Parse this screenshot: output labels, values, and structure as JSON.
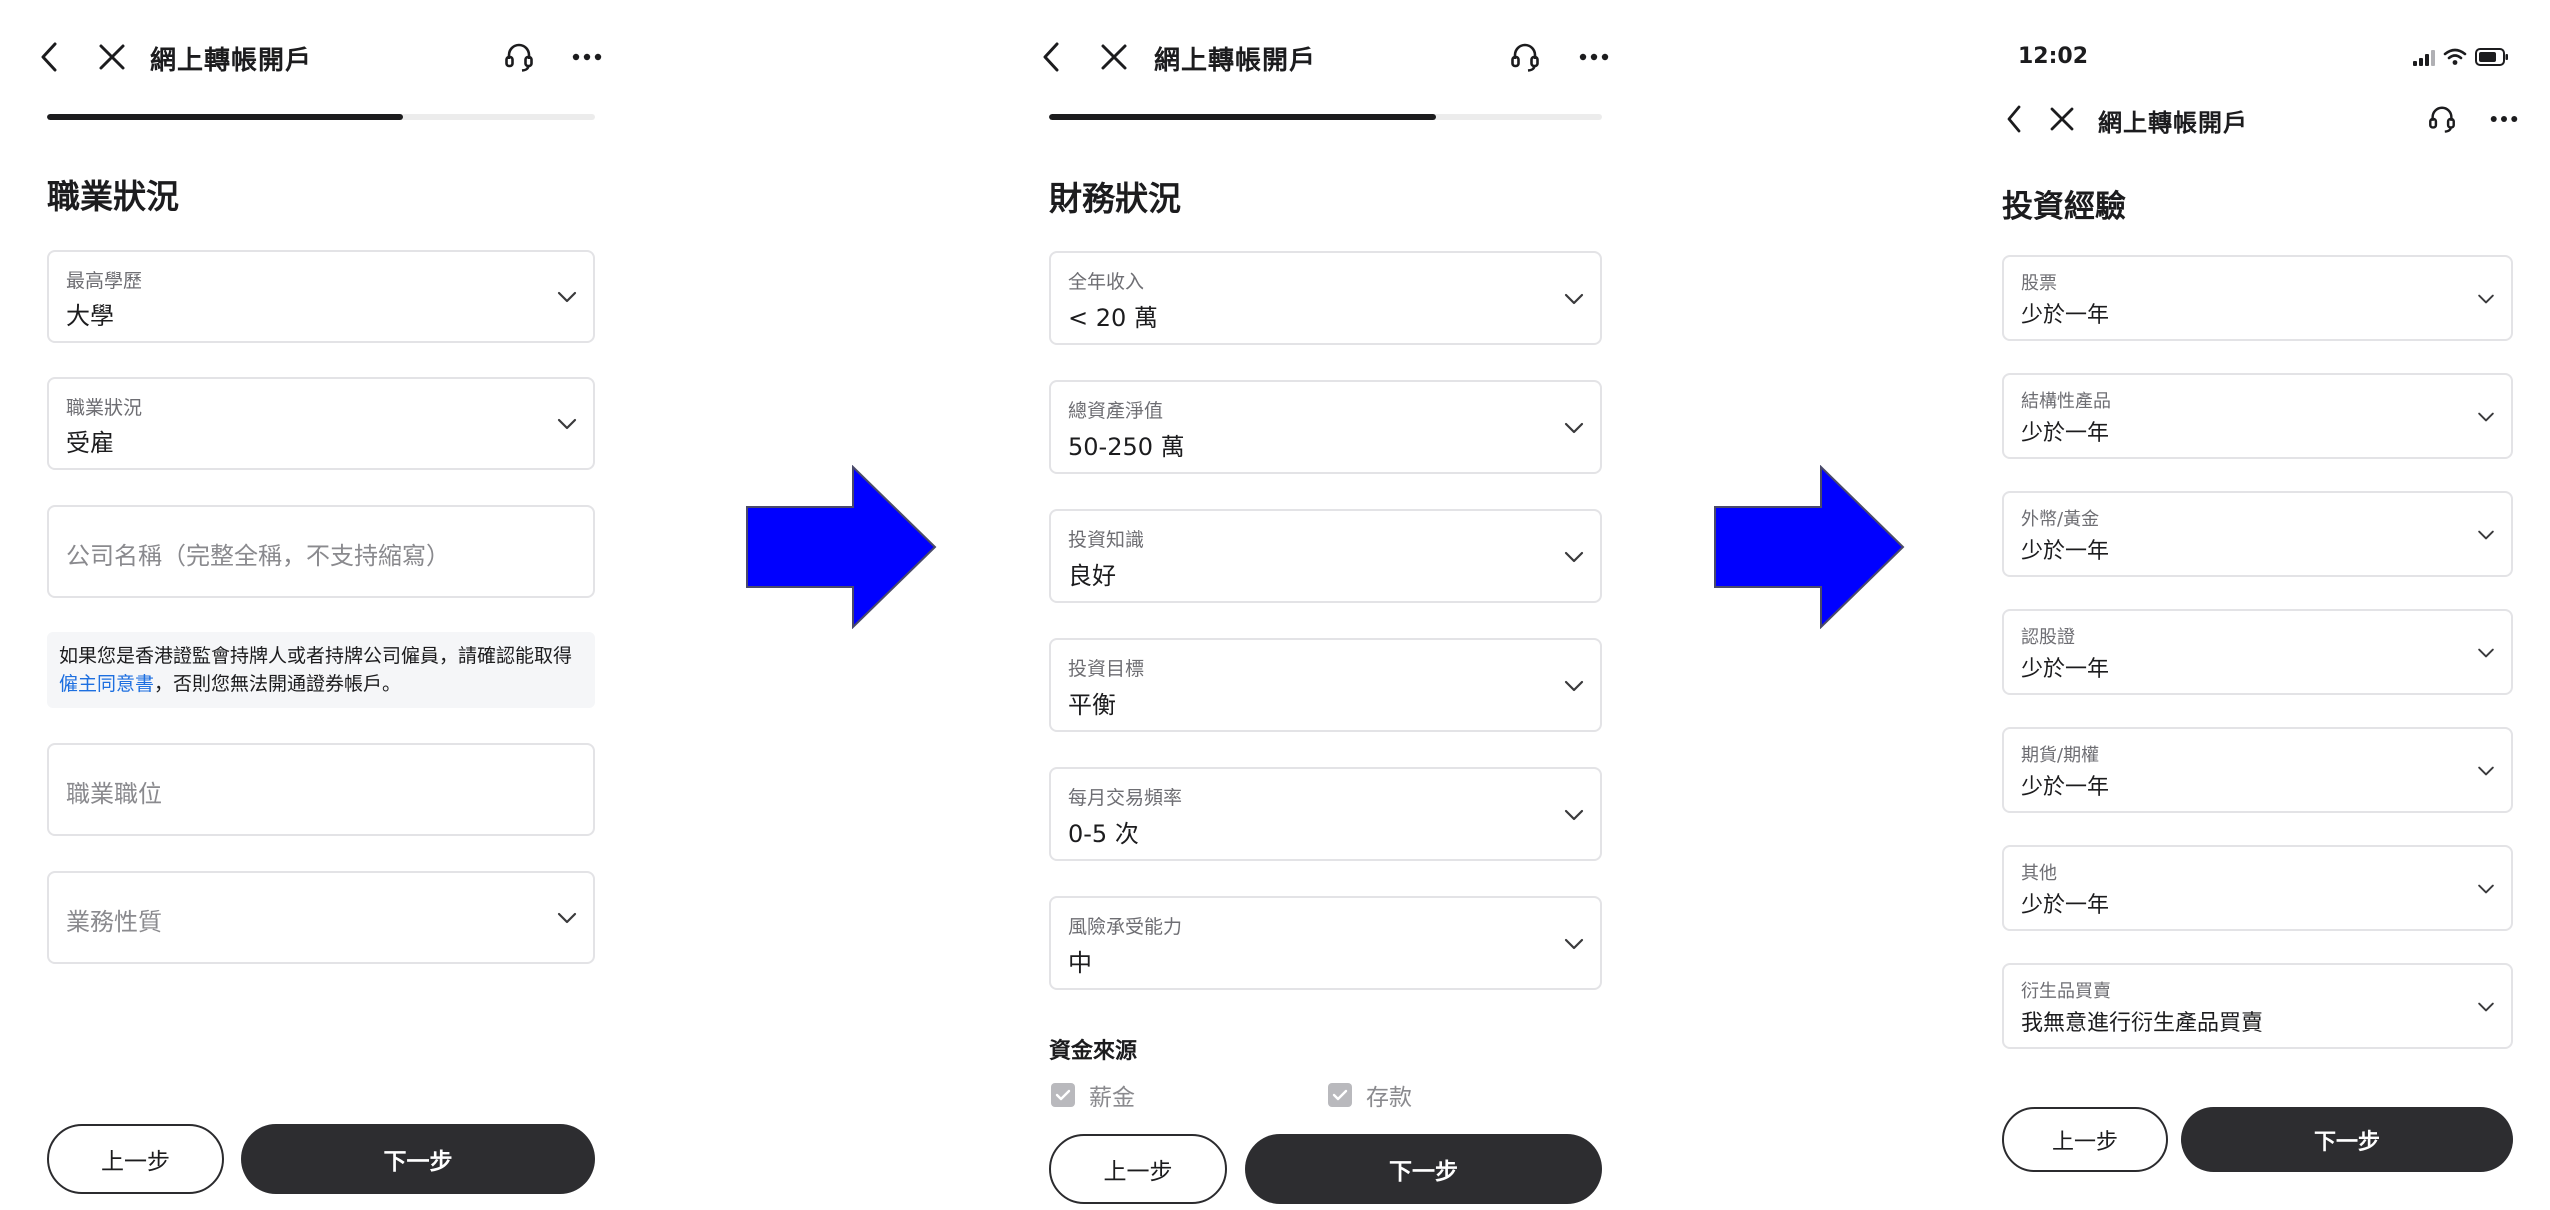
{
  "panel1": {
    "header": {
      "title": "網上轉帳開戶"
    },
    "progress": 0.65,
    "section_title": "職業狀況",
    "fields": [
      {
        "label": "最高學歷",
        "value": "大學"
      },
      {
        "label": "職業狀況",
        "value": "受雇"
      }
    ],
    "company_placeholder": "公司名稱（完整全稱，不支持縮寫）",
    "note": {
      "text_before": "如果您是香港證監會持牌人或者持牌公司僱員，請確認能取得",
      "link": "僱主同意書",
      "text_after": "，否則您無法開通證券帳戶。"
    },
    "position_placeholder": "職業職位",
    "business_placeholder": "業務性質",
    "buttons": {
      "prev": "上一步",
      "next": "下一步"
    }
  },
  "panel2": {
    "header": {
      "title": "網上轉帳開戶"
    },
    "progress": 0.7,
    "section_title": "財務狀況",
    "fields": [
      {
        "label": "全年收入",
        "value": "< 20 萬"
      },
      {
        "label": "總資產淨值",
        "value": "50-250 萬"
      },
      {
        "label": "投資知識",
        "value": "良好"
      },
      {
        "label": "投資目標",
        "value": "平衡"
      },
      {
        "label": "每月交易頻率",
        "value": "0-5 次"
      },
      {
        "label": "風險承受能力",
        "value": "中"
      }
    ],
    "funds_title": "資金來源",
    "funds_options": [
      {
        "label": "薪金",
        "checked": true
      },
      {
        "label": "存款",
        "checked": true
      }
    ],
    "buttons": {
      "prev": "上一步",
      "next": "下一步"
    }
  },
  "panel3": {
    "status_bar": {
      "time": "12:02"
    },
    "header": {
      "title": "網上轉帳開戶"
    },
    "section_title": "投資經驗",
    "fields": [
      {
        "label": "股票",
        "value": "少於一年"
      },
      {
        "label": "結構性產品",
        "value": "少於一年"
      },
      {
        "label": "外幣/黃金",
        "value": "少於一年"
      },
      {
        "label": "認股證",
        "value": "少於一年"
      },
      {
        "label": "期貨/期權",
        "value": "少於一年"
      },
      {
        "label": "其他",
        "value": "少於一年"
      },
      {
        "label": "衍生品買賣",
        "value": "我無意進行衍生產品買賣"
      }
    ],
    "buttons": {
      "prev": "上一步",
      "next": "下一步"
    }
  },
  "colors": {
    "arrow": "#0000ff",
    "dark_button": "#2d2d30",
    "link": "#1d6fe0",
    "border": "#e3e3e6"
  },
  "icons": [
    "back-arrow-icon",
    "close-icon",
    "headset-icon",
    "more-icon",
    "chevron-down-icon",
    "checkbox-checked-icon",
    "signal-icon",
    "wifi-icon",
    "battery-icon",
    "flow-arrow-icon"
  ]
}
